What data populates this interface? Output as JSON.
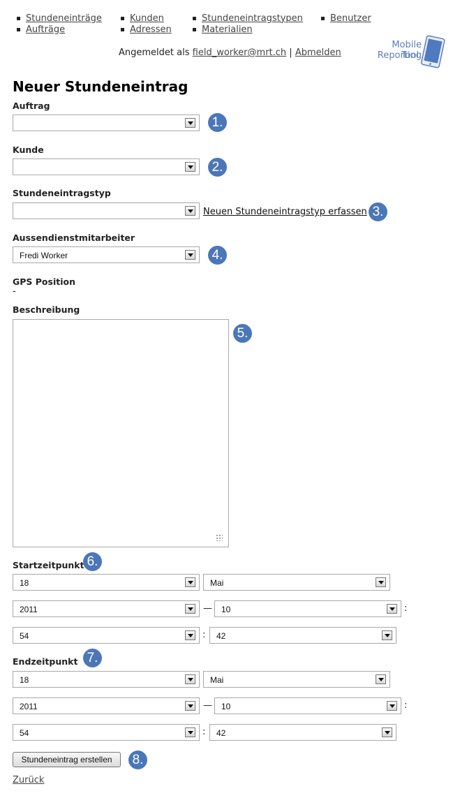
{
  "nav": {
    "col1": [
      "Stundeneinträge",
      "Aufträge"
    ],
    "col2": [
      "Kunden",
      "Adressen"
    ],
    "col3": [
      "Stundeneintragstypen",
      "Materialien"
    ],
    "col4": [
      "Benutzer"
    ]
  },
  "login": {
    "prefix": "Angemeldet als",
    "user": "field_worker@mrt.ch",
    "separator": "|",
    "logout": "Abmelden"
  },
  "logo": {
    "line1": "Mobile Reporting",
    "line2": "Tool"
  },
  "page_title": "Neuer Stundeneintrag",
  "form": {
    "auftrag": {
      "label": "Auftrag",
      "value": ""
    },
    "kunde": {
      "label": "Kunde",
      "value": ""
    },
    "typ": {
      "label": "Stundeneintragstyp",
      "value": "",
      "new_link": "Neuen Stundeneintragstyp erfassen"
    },
    "mitarbeiter": {
      "label": "Aussendienstmitarbeiter",
      "value": "Fredi Worker"
    },
    "gps": {
      "label": "GPS Position",
      "value": "-"
    },
    "beschreibung": {
      "label": "Beschreibung",
      "value": ""
    },
    "start": {
      "label": "Startzeitpunkt",
      "day": "18",
      "month": "Mai",
      "year": "2011",
      "hour": "10",
      "minute": "54",
      "second": "42"
    },
    "ende": {
      "label": "Endzeitpunkt",
      "day": "18",
      "month": "Mai",
      "year": "2011",
      "hour": "10",
      "minute": "54",
      "second": "42"
    },
    "dash": "—",
    "colon": ":",
    "submit": "Stundeneintrag erstellen",
    "back": "Zurück"
  },
  "badges": [
    "1.",
    "2.",
    "3.",
    "4.",
    "5.",
    "6.",
    "7.",
    "8."
  ],
  "colors": {
    "badge": "#4b77b9",
    "logo": "#5b7fb8"
  }
}
